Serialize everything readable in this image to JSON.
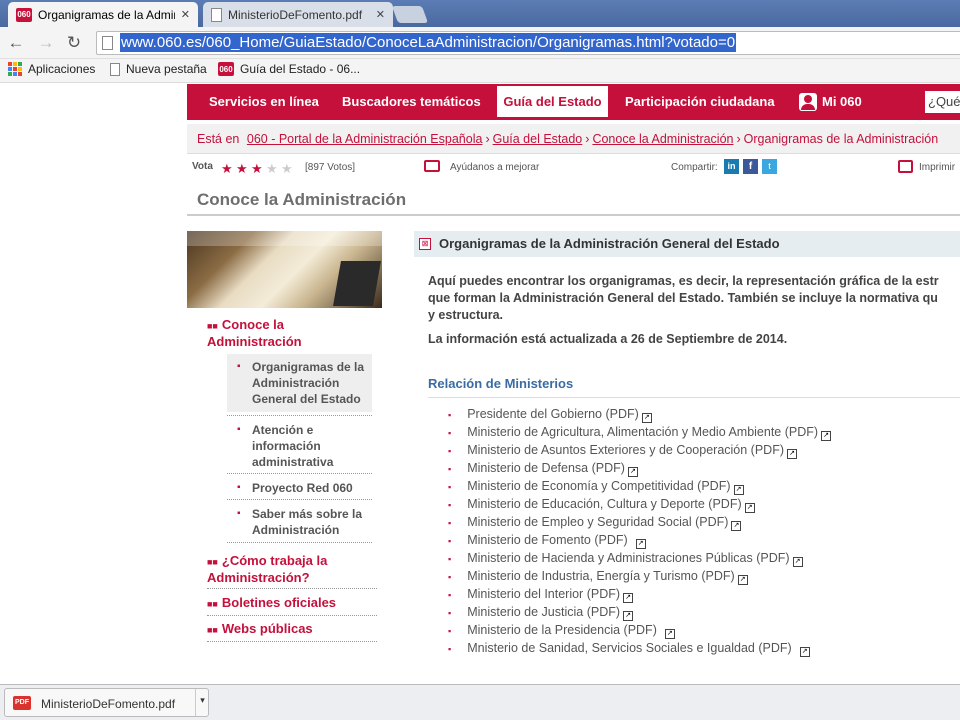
{
  "browser": {
    "tabs": [
      {
        "title": "Organigramas de la Admin",
        "active": true
      },
      {
        "title": "MinisterioDeFomento.pdf",
        "active": false
      }
    ],
    "url": "www.060.es/060_Home/GuiaEstado/ConoceLaAdministracion/Organigramas.html?votado=0",
    "bookmarks": [
      "Aplicaciones",
      "Nueva pestaña",
      "Guía del Estado - 06..."
    ],
    "favicon_text": "060"
  },
  "nav": {
    "items": [
      "Servicios en línea",
      "Buscadores temáticos",
      "Guía del Estado",
      "Participación ciudadana",
      "Mi 060"
    ],
    "search_placeholder": "¿Qué"
  },
  "breadcrumb": {
    "prefix": "Está en",
    "items": [
      "060 - Portal de la Administración Española",
      "Guía del Estado",
      "Conoce la Administración",
      "Organigramas de la Administración"
    ]
  },
  "rating": {
    "label": "Vota",
    "value": 3,
    "max": 5,
    "votes": "[897 Votos]",
    "help": "Ayúdanos a mejorar",
    "share": "Compartir:",
    "print": "Imprimir"
  },
  "page_title": "Conoce la Administración",
  "sidebar": {
    "section1": "Conoce la Administración",
    "subitems": [
      "Organigramas de la Administración General del Estado",
      "Atención e información administrativa",
      "Proyecto Red 060",
      "Saber más sobre la Administración"
    ],
    "section2": "¿Cómo trabaja la Administración?",
    "section3": "Boletines oficiales",
    "section4": "Webs públicas"
  },
  "content": {
    "heading": "Organigramas de la Administración General del Estado",
    "intro_line1": "Aquí puedes encontrar los organigramas, es decir, la representación gráfica de la estr",
    "intro_line2": "que forman la Administración General del Estado. También se incluye la normativa qu",
    "intro_line3": "y estructura.",
    "updated": "La información está actualizada a 26 de Septiembre de 2014.",
    "relacion_title": "Relación de Ministerios",
    "ministries": [
      "Presidente del Gobierno (PDF)",
      "Ministerio de Agricultura, Alimentación y Medio Ambiente (PDF)",
      "Ministerio de Asuntos Exteriores y de Cooperación (PDF)",
      "Ministerio de Defensa (PDF)",
      "Ministerio de Economía y Competitividad (PDF)",
      "Ministerio de Educación, Cultura y Deporte (PDF)",
      "Ministerio de Empleo y Seguridad Social (PDF)",
      "Ministerio de Fomento (PDF)",
      "Ministerio de Hacienda y Administraciones Públicas (PDF)",
      "Ministerio de Industria, Energía y Turismo (PDF)",
      "Ministerio del Interior (PDF)",
      "Ministerio de Justicia (PDF)",
      "Ministerio de la Presidencia (PDF)",
      "Mnisterio de Sanidad, Servicios Sociales e Igualdad (PDF)"
    ]
  },
  "download": {
    "filename": "MinisterioDeFomento.pdf",
    "icon_text": "PDF"
  },
  "colors": {
    "brand_red": "#c5103b",
    "link_blue": "#3a6ca3"
  }
}
